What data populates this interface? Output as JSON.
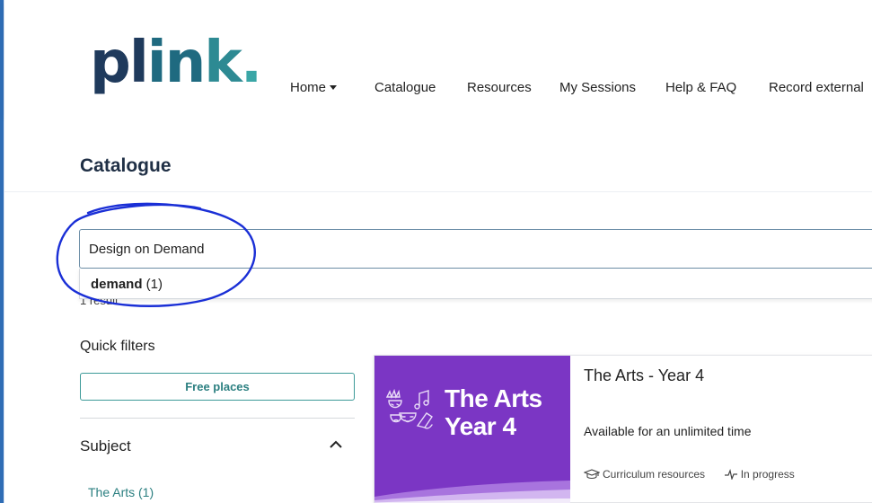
{
  "brand": {
    "logo_text_1": "pl",
    "logo_text_2": "in",
    "logo_text_3": "k",
    "logo_dot": "."
  },
  "nav": {
    "items": [
      {
        "label": "Home"
      },
      {
        "label": "Catalogue"
      },
      {
        "label": "Resources"
      },
      {
        "label": "My Sessions"
      },
      {
        "label": "Help & FAQ"
      },
      {
        "label": "Record external"
      }
    ]
  },
  "page": {
    "title": "Catalogue"
  },
  "search": {
    "value": "Design on Demand",
    "suggestion_term": "demand",
    "suggestion_count": " (1)",
    "result_count": "1 result"
  },
  "sidebar": {
    "quick_filters_label": "Quick filters",
    "free_places_label": "Free places",
    "subject_label": "Subject",
    "subject_items": [
      {
        "label": "The Arts  (1)"
      }
    ]
  },
  "card": {
    "image_line_1": "The Arts",
    "image_line_2": "Year 4",
    "title": "The Arts - Year 4",
    "availability": "Available for an unlimited time",
    "meta_resources": "Curriculum resources",
    "meta_status": "In progress"
  },
  "colors": {
    "accent_teal": "#2b7f80",
    "card_purple": "#7b36c4",
    "annotation_blue": "#1a2fd6",
    "frame_blue": "#2f6db5"
  },
  "icons": [
    "caret-down-icon",
    "arts-masks-icon",
    "graduation-cap-icon",
    "activity-pulse-icon",
    "chevron-up-icon"
  ]
}
